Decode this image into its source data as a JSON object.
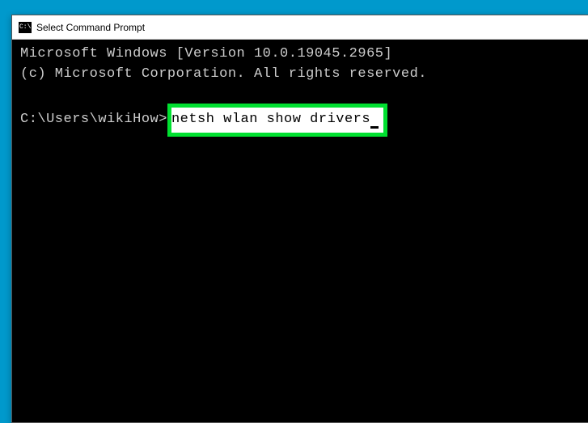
{
  "window": {
    "title": "Select Command Prompt",
    "icon_label": "C:\\"
  },
  "terminal": {
    "line1": "Microsoft Windows [Version 10.0.19045.2965]",
    "line2": "(c) Microsoft Corporation. All rights reserved.",
    "prompt": "C:\\Users\\wikiHow>",
    "command": "netsh wlan show drivers"
  },
  "highlight_color": "#00e030"
}
